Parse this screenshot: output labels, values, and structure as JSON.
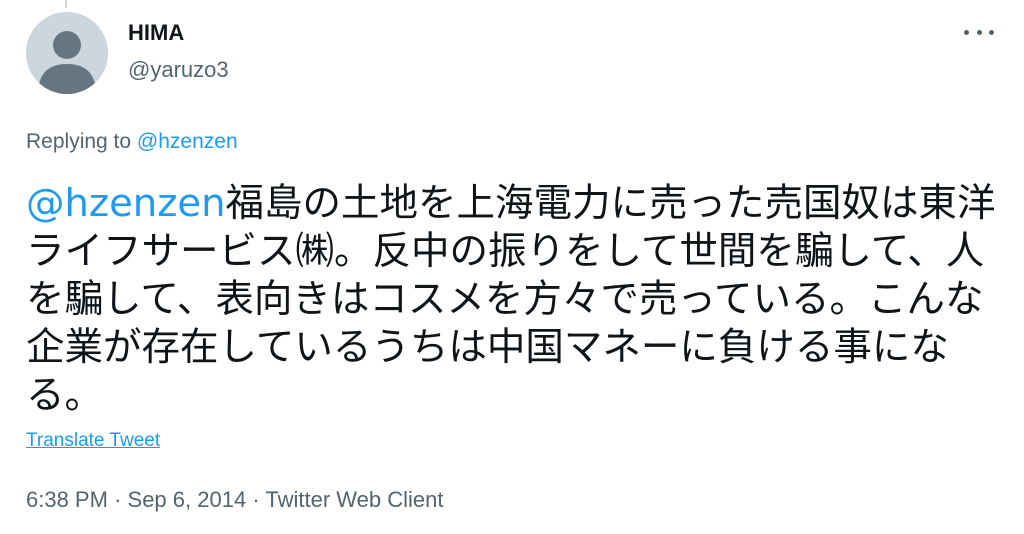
{
  "tweet": {
    "display_name": "HIMA",
    "handle": "@yaruzo3",
    "replying_prefix": "Replying to",
    "replying_to": "@hzenzen",
    "text_mention": "@hzenzen",
    "text_body": "福島の土地を上海電力に売った売国奴は東洋ライフサービス㈱。反中の振りをして世間を騙して、人を騙して、表向きはコスメを方々で売っている。こんな企業が存在しているうちは中国マネーに負ける事になる。",
    "translate_label": "Translate Tweet",
    "time": "6:38 PM",
    "date": "Sep 6, 2014",
    "source": "Twitter Web Client",
    "separator": "·"
  },
  "icons": {
    "avatar": "default-avatar-icon",
    "more": "more-options-icon"
  },
  "colors": {
    "link": "#1d9bf0",
    "secondary_text": "#536471",
    "primary_text": "#0f1419",
    "avatar_bg": "#ccd6dd"
  }
}
